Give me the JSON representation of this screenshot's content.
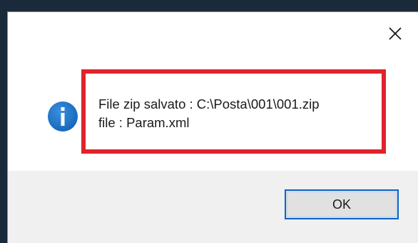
{
  "dialog": {
    "close_icon": "close-icon",
    "info_icon": "info-icon",
    "message_lines": [
      "File zip salvato : C:\\Posta\\001\\001.zip",
      "file : Param.xml"
    ],
    "ok_label": "OK"
  },
  "colors": {
    "highlight_border": "#e0232b",
    "info_icon_fill": "#1a73c6",
    "ok_border": "#0a64c8",
    "footer_bg": "#f0f0f0"
  }
}
